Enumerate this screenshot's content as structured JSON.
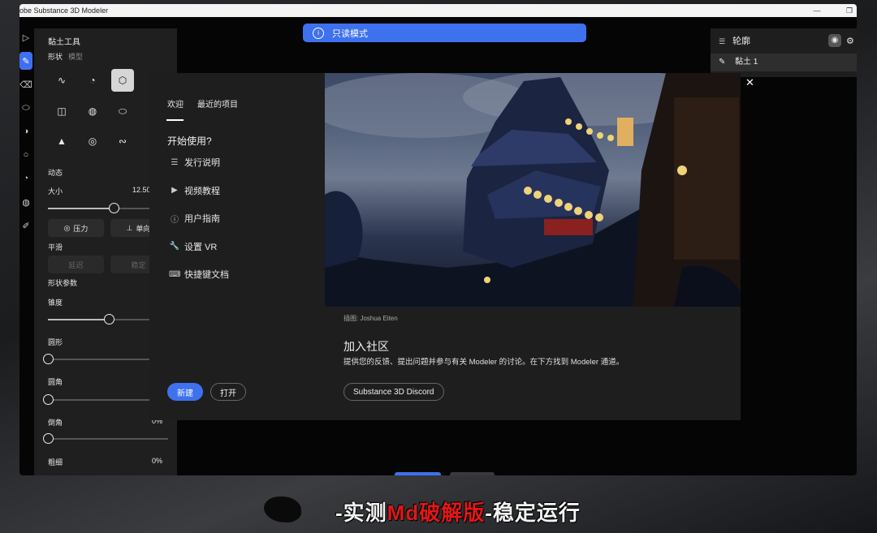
{
  "app": {
    "title": "obe Substance 3D Modeler"
  },
  "notification": {
    "icon": "info-icon",
    "text": "只读模式"
  },
  "tools": [
    {
      "name": "select-tool-icon",
      "glyph": "▷"
    },
    {
      "name": "clay-brush-tool-icon",
      "glyph": "✎"
    },
    {
      "name": "erase-tool-icon",
      "glyph": "⌫"
    },
    {
      "name": "smooth-tool-icon",
      "glyph": "⬭"
    },
    {
      "name": "symmetry-tool-icon",
      "glyph": "◑"
    },
    {
      "name": "lasso-tool-icon",
      "glyph": "○"
    },
    {
      "name": "rotate-tool-icon",
      "glyph": "◔"
    },
    {
      "name": "material-tool-icon",
      "glyph": "◍"
    },
    {
      "name": "paint-tool-icon",
      "glyph": "✐"
    }
  ],
  "panel": {
    "title": "黏土工具",
    "tab_shape": "形状",
    "tab_model": "模型",
    "section_dynamics": "动态",
    "size_label": "大小",
    "size_value": "12.50",
    "size_level": 0.65,
    "pressure_label": "压力",
    "single_label": "单向",
    "smooth_label": "平滑",
    "smooth_delay": "延迟",
    "smooth_stable": "稳定",
    "section_params": "形状参数",
    "taper_label": "锥度",
    "taper_level": 0.6,
    "round_label": "圆形",
    "round_level": 0,
    "fillet_label": "圆角",
    "fillet_level": 0,
    "chamfer_label": "倒角",
    "chamfer_value": "0%",
    "chamfer_level": 0,
    "thickness_label": "粗细",
    "thickness_value": "0%"
  },
  "outline": {
    "title": "轮廓",
    "item": "黏土 1"
  },
  "dialog": {
    "tab_welcome": "欢迎",
    "tab_recent": "最近的项目",
    "get_started": "开始使用?",
    "menu": [
      {
        "icon": "list-icon",
        "glyph": "☰",
        "label": "发行说明"
      },
      {
        "icon": "video-icon",
        "glyph": "▶",
        "label": "视频教程"
      },
      {
        "icon": "info-icon",
        "glyph": "ⓘ",
        "label": "用户指南"
      },
      {
        "icon": "wrench-icon",
        "glyph": "🔧",
        "label": "设置 VR"
      },
      {
        "icon": "keyboard-icon",
        "glyph": "⌨",
        "label": "快捷键文档"
      }
    ],
    "new_label": "新建",
    "open_label": "打开",
    "credit": "插图: Joshua Eiten",
    "community_title": "加入社区",
    "community_desc": "提供您的反馈、提出问题并参与有关 Modeler 的讨论。在下方找到 Modeler 通道。",
    "discord_label": "Substance 3D Discord"
  },
  "caption": {
    "prefix": "-实测",
    "highlight": "Md破解版",
    "suffix": "-稳定运行"
  }
}
